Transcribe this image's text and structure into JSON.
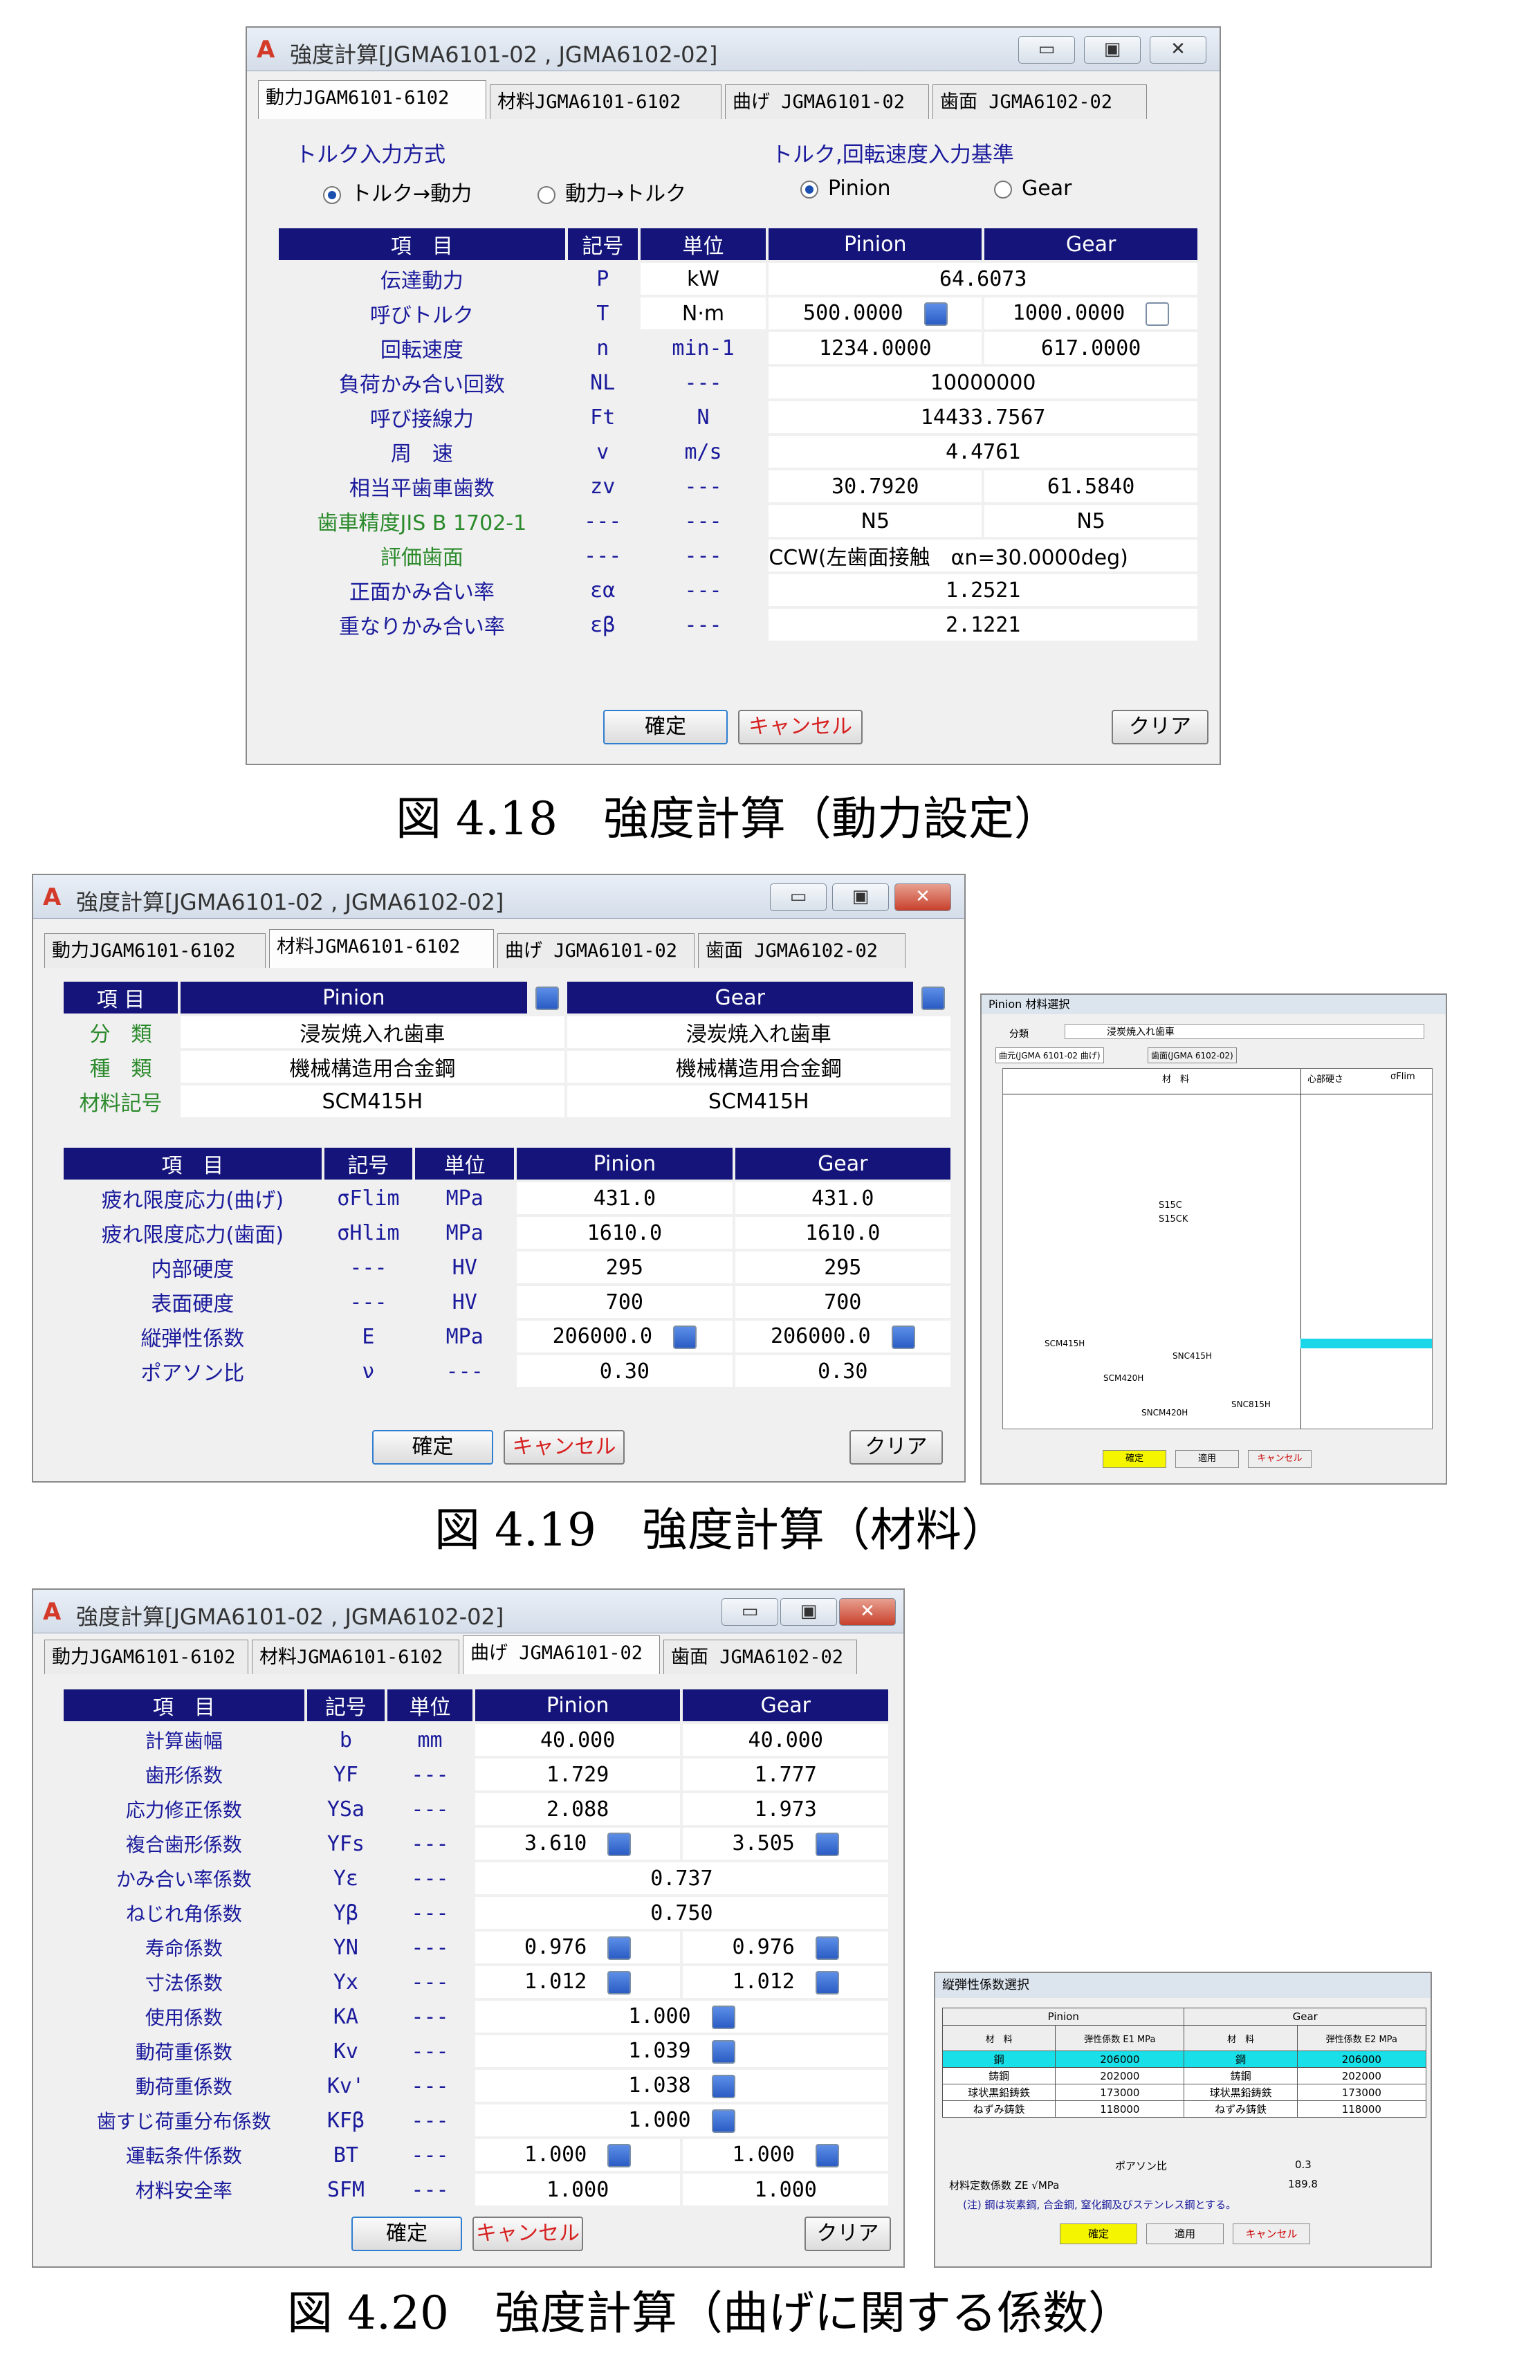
{
  "window_title": "強度計算[JGMA6101-02 , JGMA6102-02]",
  "titlebar_buttons": [
    "▭",
    "▣",
    "✕"
  ],
  "tabs": [
    "動力JGAM6101-6102",
    "材料JGMA6101-6102",
    "曲げ JGMA6101-02",
    "歯面 JGMA6102-02"
  ],
  "buttons": {
    "ok": "確定",
    "cancel": "キャンセル",
    "clear": "クリア"
  },
  "fig1": {
    "caption": "図 4.18　強度計算（動力設定）",
    "torque_group": {
      "label": "トルク入力方式",
      "opt1": "トルク→動力",
      "opt2": "動力→トルク"
    },
    "basis_group": {
      "label": "トルク,回転速度入力基準",
      "opt1": "Pinion",
      "opt2": "Gear"
    },
    "headers": [
      "項　目",
      "記号",
      "単位",
      "Pinion",
      "Gear"
    ],
    "rows": [
      {
        "label": "伝達動力",
        "sym": "P",
        "unit": "kW",
        "span": "64.6073"
      },
      {
        "label": "呼びトルク",
        "sym": "T",
        "unit": "N·m",
        "pinion": "500.0000",
        "gear": "1000.0000"
      },
      {
        "label": "回転速度",
        "sym": "n",
        "unit": "min-1",
        "pinion": "1234.0000",
        "gear": "617.0000"
      },
      {
        "label": "負荷かみ合い回数",
        "sym": "NL",
        "unit": "---",
        "span": "10000000"
      },
      {
        "label": "呼び接線力",
        "sym": "Ft",
        "unit": "N",
        "span": "14433.7567"
      },
      {
        "label": "周　速",
        "sym": "v",
        "unit": "m/s",
        "span": "4.4761"
      },
      {
        "label": "相当平歯車歯数",
        "sym": "zv",
        "unit": "---",
        "pinion": "30.7920",
        "gear": "61.5840"
      },
      {
        "label": "歯車精度JIS B 1702-1",
        "sym": "---",
        "unit": "---",
        "pinion": "N5",
        "gear": "N5"
      },
      {
        "label": "評価歯面",
        "sym": "---",
        "unit": "---",
        "span": "CCW(左歯面接触　αn=30.0000deg)"
      },
      {
        "label": "正面かみ合い率",
        "sym": "εα",
        "unit": "---",
        "span": "1.2521"
      },
      {
        "label": "重なりかみ合い率",
        "sym": "εβ",
        "unit": "---",
        "span": "2.1221"
      }
    ]
  },
  "fig2": {
    "caption": "図 4.19　強度計算（材料）",
    "top_headers": [
      "項 目",
      "Pinion",
      "Gear"
    ],
    "top_rows": [
      {
        "label": "分　類",
        "pinion": "浸炭焼入れ歯車",
        "gear": "浸炭焼入れ歯車"
      },
      {
        "label": "種　類",
        "pinion": "機械構造用合金鋼",
        "gear": "機械構造用合金鋼"
      },
      {
        "label": "材料記号",
        "pinion": "SCM415H",
        "gear": "SCM415H"
      }
    ],
    "headers": [
      "項　目",
      "記号",
      "単位",
      "Pinion",
      "Gear"
    ],
    "rows": [
      {
        "label": "疲れ限度応力(曲げ)",
        "sym": "σFlim",
        "unit": "MPa",
        "pinion": "431.0",
        "gear": "431.0"
      },
      {
        "label": "疲れ限度応力(歯面)",
        "sym": "σHlim",
        "unit": "MPa",
        "pinion": "1610.0",
        "gear": "1610.0"
      },
      {
        "label": "内部硬度",
        "sym": "---",
        "unit": "HV",
        "pinion": "295",
        "gear": "295"
      },
      {
        "label": "表面硬度",
        "sym": "---",
        "unit": "HV",
        "pinion": "700",
        "gear": "700"
      },
      {
        "label": "縦弾性係数",
        "sym": "E",
        "unit": "MPa",
        "pinion": "206000.0",
        "gear": "206000.0"
      },
      {
        "label": "ポアソン比",
        "sym": "ν",
        "unit": "---",
        "pinion": "0.30",
        "gear": "0.30"
      }
    ],
    "side_panel": {
      "title": "Pinion 材料選択",
      "category": "分類",
      "category_value": "浸炭焼入れ歯車",
      "tabs": [
        "曲元(JGMA 6101-02 曲げ)",
        "歯面(JGMA 6102-02)"
      ],
      "col_headers": [
        "材　料",
        "心部硬さ",
        "σFlim"
      ],
      "materials": [
        "S15C",
        "S15CK",
        "SCM415H",
        "SCM420H",
        "SNC415H",
        "SNCM420H",
        "SNC815H"
      ],
      "buttons": [
        "確定",
        "適用",
        "キャンセル"
      ]
    }
  },
  "fig3": {
    "caption": "図 4.20　強度計算（曲げに関する係数）",
    "headers": [
      "項　目",
      "記号",
      "単位",
      "Pinion",
      "Gear"
    ],
    "rows": [
      {
        "label": "計算歯幅",
        "sym": "b",
        "unit": "mm",
        "pinion": "40.000",
        "gear": "40.000"
      },
      {
        "label": "歯形係数",
        "sym": "YF",
        "unit": "---",
        "pinion": "1.729",
        "gear": "1.777"
      },
      {
        "label": "応力修正係数",
        "sym": "YSa",
        "unit": "---",
        "pinion": "2.088",
        "gear": "1.973"
      },
      {
        "label": "複合歯形係数",
        "sym": "YFs",
        "unit": "---",
        "pinion": "3.610",
        "gear": "3.505"
      },
      {
        "label": "かみ合い率係数",
        "sym": "Yε",
        "unit": "---",
        "span": "0.737"
      },
      {
        "label": "ねじれ角係数",
        "sym": "Yβ",
        "unit": "---",
        "span": "0.750"
      },
      {
        "label": "寿命係数",
        "sym": "YN",
        "unit": "---",
        "pinion": "0.976",
        "gear": "0.976"
      },
      {
        "label": "寸法係数",
        "sym": "Yx",
        "unit": "---",
        "pinion": "1.012",
        "gear": "1.012"
      },
      {
        "label": "使用係数",
        "sym": "KA",
        "unit": "---",
        "span": "1.000"
      },
      {
        "label": "動荷重係数",
        "sym": "Kv",
        "unit": "---",
        "span": "1.039"
      },
      {
        "label": "動荷重係数",
        "sym": "Kv'",
        "unit": "---",
        "span": "1.038"
      },
      {
        "label": "歯すじ荷重分布係数",
        "sym": "KFβ",
        "unit": "---",
        "span": "1.000"
      },
      {
        "label": "運転条件係数",
        "sym": "BT",
        "unit": "---",
        "pinion": "1.000",
        "gear": "1.000"
      },
      {
        "label": "材料安全率",
        "sym": "SFM",
        "unit": "---",
        "pinion": "1.000",
        "gear": "1.000"
      }
    ],
    "side_panel": {
      "title": "縦弾性係数選択",
      "cols": [
        "Pinion",
        "Gear"
      ],
      "sub_headers": [
        "材　料",
        "弾性係数 E1 MPa",
        "材　料",
        "弾性係数 E2 MPa"
      ],
      "rows": [
        [
          "鋼",
          "206000",
          "鋼",
          "206000"
        ],
        [
          "鋳鋼",
          "202000",
          "鋳鋼",
          "202000"
        ],
        [
          "球状黒鉛鋳鉄",
          "173000",
          "球状黒鉛鋳鉄",
          "173000"
        ],
        [
          "ねずみ鋳鉄",
          "118000",
          "ねずみ鋳鉄",
          "118000"
        ]
      ],
      "poisson_label": "ポアソン比",
      "poisson": "0.3",
      "ze_label": "材料定数係数 ZE √MPa",
      "ze": "189.8",
      "note": "(注) 鋼は炭素鋼, 合金鋼, 窒化鋼及びステンレス鋼とする。",
      "buttons": [
        "確定",
        "適用",
        "キャンセル"
      ]
    }
  }
}
